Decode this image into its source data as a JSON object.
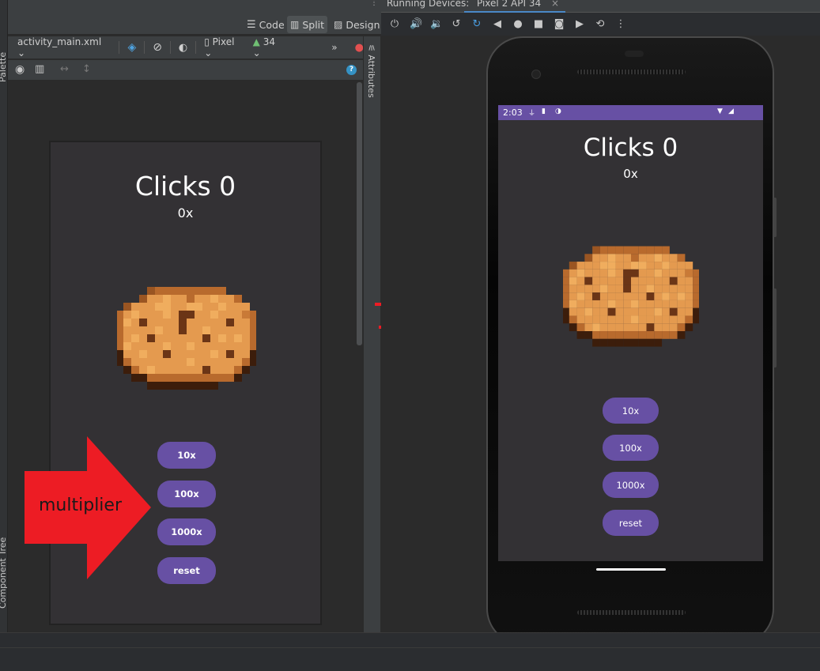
{
  "ide": {
    "mode_code": "Code",
    "mode_split": "Split",
    "mode_design": "Design",
    "file_name": "activity_main.xml",
    "device_name": "Pixel",
    "api_level": "34",
    "palette_tab": "Palette",
    "attributes_tab": "Attributes",
    "component_tree_tab": "Component Tree",
    "running_devices_label": "Running Devices:",
    "running_device_tab": "Pixel 2 API 34"
  },
  "preview": {
    "title": "Clicks 0",
    "multiplier": "0x",
    "buttons": [
      "10x",
      "100x",
      "1000x",
      "reset"
    ]
  },
  "annotation": {
    "arrow_label": "multiplier",
    "color": "#ed1c24"
  },
  "device": {
    "status_time": "2:03",
    "title": "Clicks 0",
    "multiplier": "0x",
    "buttons": [
      "10x",
      "100x",
      "1000x",
      "reset"
    ]
  },
  "colors": {
    "accent": "#6750a4",
    "background": "#333134"
  }
}
